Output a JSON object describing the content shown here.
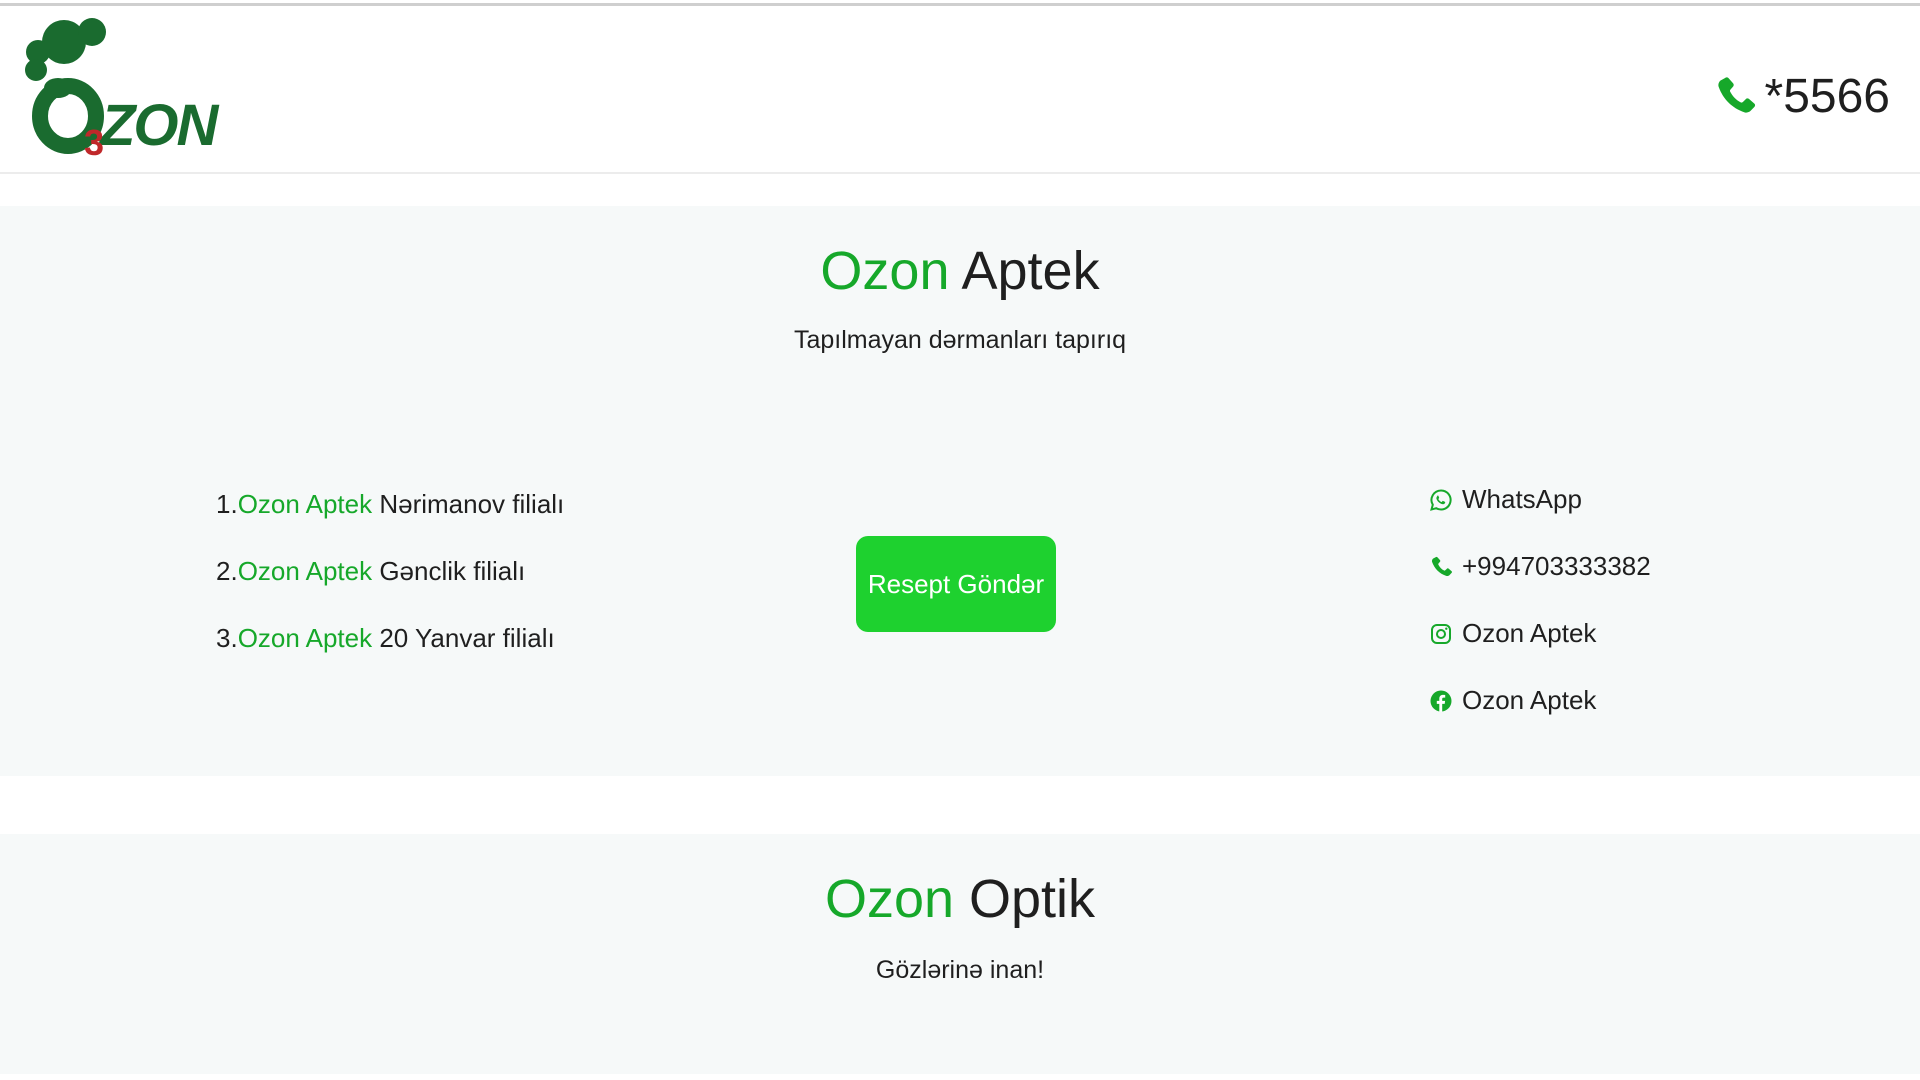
{
  "header": {
    "logo_text": "ZON",
    "logo_subscript": "3",
    "phone": "*5566"
  },
  "colors": {
    "brand_green": "#16a82a",
    "button_green": "#1ed12f",
    "logo_green": "#1a6b2f",
    "logo_red": "#c0282a",
    "section_bg": "#f6f9f9"
  },
  "aptek": {
    "title_brand": "Ozon",
    "title_rest": " Aptek",
    "subtitle": "Tapılmayan dərmanları tapırıq",
    "branches": [
      {
        "prefix": "1.",
        "brand": "Ozon Aptek",
        "suffix": " Nərimanov filialı"
      },
      {
        "prefix": "2.",
        "brand": "Ozon Aptek",
        "suffix": " Gənclik filialı"
      },
      {
        "prefix": "3.",
        "brand": "Ozon Aptek",
        "suffix": " 20 Yanvar filialı"
      }
    ],
    "button_label": "Resept Göndər",
    "contacts": [
      {
        "icon": "whatsapp-icon",
        "label": "WhatsApp"
      },
      {
        "icon": "phone-icon",
        "label": "+994703333382"
      },
      {
        "icon": "instagram-icon",
        "label": "Ozon Aptek"
      },
      {
        "icon": "facebook-icon",
        "label": "Ozon Aptek"
      }
    ]
  },
  "optik": {
    "title_brand": "Ozon",
    "title_rest": " Optik",
    "subtitle": "Gözlərinə inan!"
  }
}
